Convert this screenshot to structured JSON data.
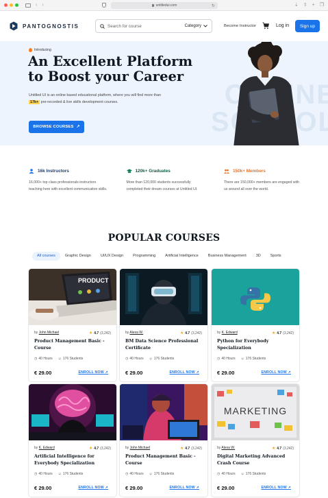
{
  "browser": {
    "url": "untitledui.com"
  },
  "nav": {
    "brand": "PANTOGNOSTIS",
    "search_placeholder": "Search for course",
    "category_label": "Category",
    "become_instructor": "Become Instructor",
    "login": "Log in",
    "signup": "Sign up"
  },
  "hero": {
    "badge": "Introducing",
    "title_line1": "An Excellent Platform",
    "title_line2": "to Boost your Career",
    "desc_part1": "Untitled UI is an online based educational platform, where you will find more than",
    "desc_highlight": "17k+",
    "desc_part2": "pre-recorded & live skills development courses.",
    "cta": "BROWSE COURSES",
    "bg_line1": "ONLINE",
    "bg_line2": "SCHOOL"
  },
  "stats": [
    {
      "title": "16k Instructors",
      "text": "16,000+ top class professionals instructors teaching here with excellent communication skills.",
      "color": "#1a73e8"
    },
    {
      "title": "120k+ Graduates",
      "text": "More than 120,000 students successfully completed their dream courses at Untitled UI.",
      "color": "#0f7b5a"
    },
    {
      "title": "150k+ Members",
      "text": "There are 150,000+ members are engaged with us around all over the world.",
      "color": "#e8742a"
    }
  ],
  "popular": {
    "title": "POPULAR COURSES",
    "tabs": [
      "All courses",
      "Graphic Design",
      "UI/UX Design",
      "Programming",
      "Artificial Intelligence",
      "Business Management",
      "3D",
      "Sports"
    ]
  },
  "common": {
    "by": "by",
    "enroll": "ENROLL NOW",
    "hours": "40 Hours",
    "students": "176 Students",
    "price": "€ 29.00",
    "rating": "4.7",
    "reviews": "(3,242)"
  },
  "courses": [
    {
      "author": "John Michael",
      "title": "Product Management Basic - Course",
      "image_text": "PRODUCT"
    },
    {
      "author": "Alexa W.",
      "title": "BM Data Science Professional Certificate"
    },
    {
      "author": "K. Edward",
      "title": "Python for Everybody Specialization"
    },
    {
      "author": "K. Edward",
      "title": "Artificial Intelligence for Everybody Specialization"
    },
    {
      "author": "John Michael",
      "title": "Product Management Basic - Course"
    },
    {
      "author": "Alexa W.",
      "title": "Digital Marketing Advanced Crash Course",
      "image_text": "MARKETING"
    }
  ]
}
